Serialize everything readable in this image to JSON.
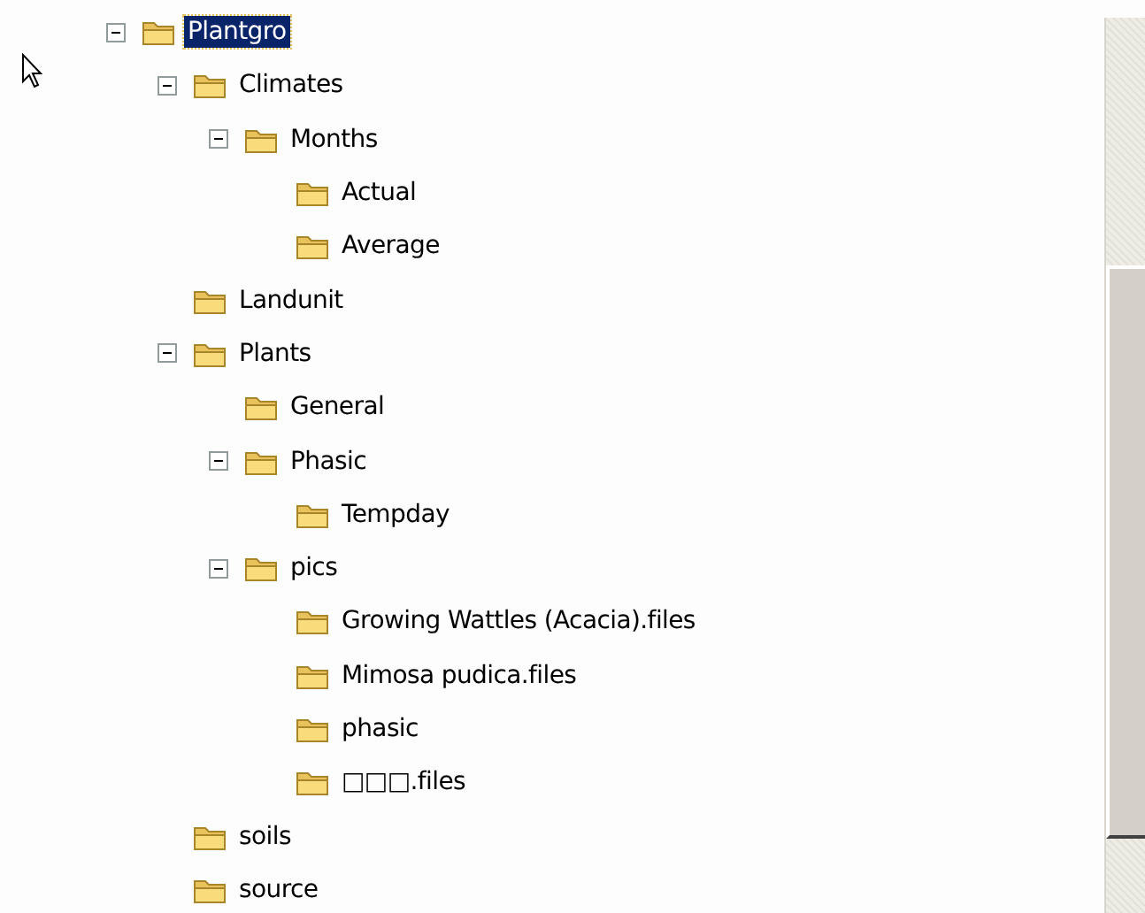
{
  "tree": [
    {
      "label": "Plantgro",
      "selected": true,
      "expanded": true,
      "children": [
        {
          "label": "Climates",
          "selected": false,
          "expanded": true,
          "children": [
            {
              "label": "Months",
              "selected": false,
              "expanded": true,
              "children": [
                {
                  "label": "Actual",
                  "selected": false
                },
                {
                  "label": "Average",
                  "selected": false
                }
              ]
            }
          ]
        },
        {
          "label": "Landunit",
          "selected": false
        },
        {
          "label": "Plants",
          "selected": false,
          "expanded": true,
          "children": [
            {
              "label": "General",
              "selected": false
            },
            {
              "label": "Phasic",
              "selected": false,
              "expanded": true,
              "children": [
                {
                  "label": "Tempday",
                  "selected": false
                }
              ]
            },
            {
              "label": "pics",
              "selected": false,
              "expanded": true,
              "children": [
                {
                  "label": "Growing Wattles (Acacia).files",
                  "selected": false
                },
                {
                  "label": "Mimosa pudica.files",
                  "selected": false
                },
                {
                  "label": "phasic",
                  "selected": false
                },
                {
                  "label": "□□□.files",
                  "selected": false
                }
              ]
            }
          ]
        },
        {
          "label": "soils",
          "selected": false
        },
        {
          "label": "source",
          "selected": false
        }
      ]
    }
  ]
}
